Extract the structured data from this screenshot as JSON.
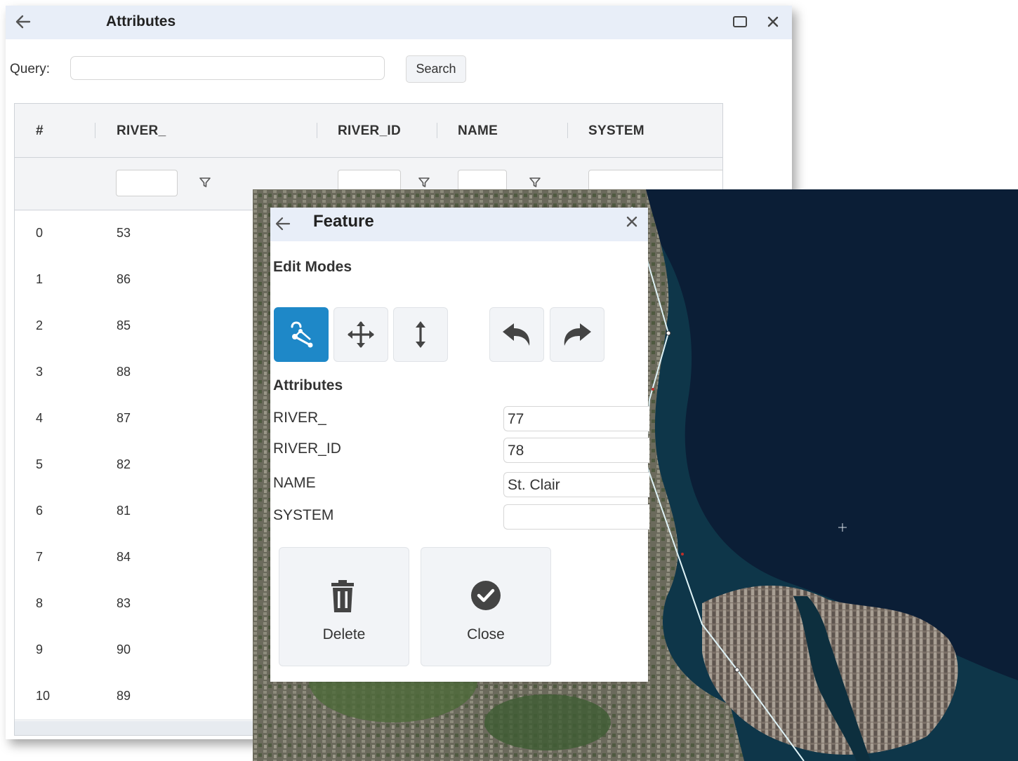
{
  "attributes_window": {
    "title": "Attributes",
    "icons": {
      "back": "arrow-left-icon",
      "maximize": "maximize-icon",
      "close": "close-icon"
    },
    "query_label": "Query:",
    "query_value": "",
    "search_label": "Search",
    "columns": [
      "#",
      "RIVER_",
      "RIVER_ID",
      "NAME",
      "SYSTEM"
    ],
    "rows": [
      {
        "index": "0",
        "river": "53"
      },
      {
        "index": "1",
        "river": "86"
      },
      {
        "index": "2",
        "river": "85"
      },
      {
        "index": "3",
        "river": "88"
      },
      {
        "index": "4",
        "river": "87"
      },
      {
        "index": "5",
        "river": "82"
      },
      {
        "index": "6",
        "river": "81"
      },
      {
        "index": "7",
        "river": "84"
      },
      {
        "index": "8",
        "river": "83"
      },
      {
        "index": "9",
        "river": "90"
      },
      {
        "index": "10",
        "river": "89"
      }
    ]
  },
  "feature_panel": {
    "title": "Feature",
    "edit_modes_heading": "Edit Modes",
    "tools": [
      "reshape-icon",
      "move-icon",
      "vertical-resize-icon",
      "undo-icon",
      "redo-icon"
    ],
    "attributes_heading": "Attributes",
    "fields": [
      {
        "label": "RIVER_",
        "value": "77"
      },
      {
        "label": "RIVER_ID",
        "value": "78"
      },
      {
        "label": "NAME",
        "value": "St. Clair"
      },
      {
        "label": "SYSTEM",
        "value": ""
      }
    ],
    "delete_label": "Delete",
    "close_label": "Close"
  },
  "colors": {
    "accent": "#1e88c8",
    "titlebar": "#e8eef8",
    "water": "#0b1e36"
  }
}
